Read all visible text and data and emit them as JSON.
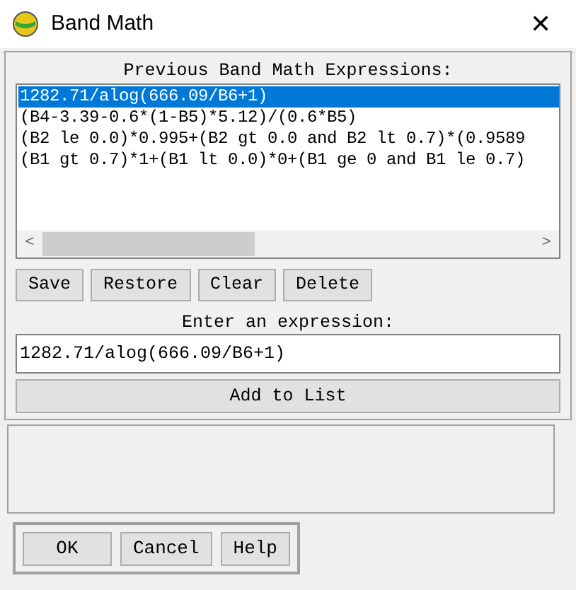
{
  "window": {
    "title": "Band Math",
    "close": "✕"
  },
  "previous": {
    "label": "Previous Band Math Expressions:",
    "items": [
      {
        "text": "1282.71/alog(666.09/B6+1)",
        "selected": true
      },
      {
        "text": "(B4-3.39-0.6*(1-B5)*5.12)/(0.6*B5)",
        "selected": false
      },
      {
        "text": "(B2 le 0.0)*0.995+(B2 gt 0.0 and B2 lt 0.7)*(0.9589",
        "selected": false
      },
      {
        "text": "(B1 gt 0.7)*1+(B1 lt 0.0)*0+(B1 ge 0 and B1 le 0.7)",
        "selected": false
      }
    ],
    "scroll_left": "<",
    "scroll_right": ">"
  },
  "list_buttons": [
    "Save",
    "Restore",
    "Clear",
    "Delete"
  ],
  "expression": {
    "label": "Enter an expression:",
    "value": "1282.71/alog(666.09/B6+1)"
  },
  "add_button": "Add to List",
  "dialog_buttons": [
    "OK",
    "Cancel",
    "Help"
  ]
}
